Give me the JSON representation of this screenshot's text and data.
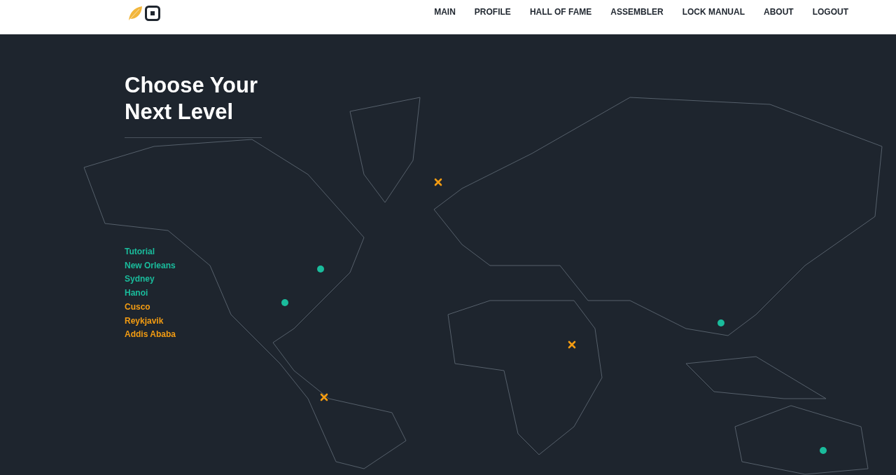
{
  "nav": {
    "items": [
      {
        "label": "MAIN"
      },
      {
        "label": "PROFILE"
      },
      {
        "label": "HALL OF FAME"
      },
      {
        "label": "ASSEMBLER"
      },
      {
        "label": "LOCK MANUAL"
      },
      {
        "label": "ABOUT"
      },
      {
        "label": "LOGOUT"
      }
    ]
  },
  "heading": "Choose Your Next Level",
  "levels": [
    {
      "name": "Tutorial",
      "completed": true
    },
    {
      "name": "New Orleans",
      "completed": true
    },
    {
      "name": "Sydney",
      "completed": true
    },
    {
      "name": "Hanoi",
      "completed": true
    },
    {
      "name": "Cusco",
      "completed": false
    },
    {
      "name": "Reykjavik",
      "completed": false
    },
    {
      "name": "Addis Ababa",
      "completed": false
    }
  ]
}
